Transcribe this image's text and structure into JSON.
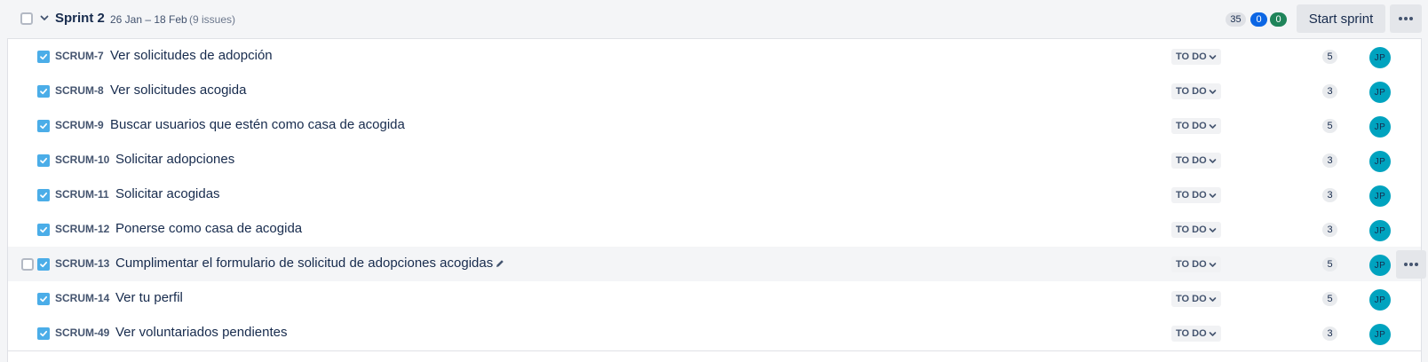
{
  "sprint": {
    "name": "Sprint 2",
    "dates": "26 Jan – 18 Feb",
    "issue_count": "(9 issues)",
    "story_points": {
      "total": "35",
      "in_progress": "0",
      "done": "0"
    },
    "start_button_label": "Start sprint"
  },
  "colors": {
    "in_progress_pill": "#0c66e4",
    "done_pill": "#1f845a",
    "avatar": "#00a3bf",
    "task_icon": "#4bade8"
  },
  "issues": [
    {
      "key": "SCRUM-7",
      "summary": "Ver solicitudes de adopción",
      "status": "TO DO",
      "points": "5",
      "assignee": "JP"
    },
    {
      "key": "SCRUM-8",
      "summary": "Ver solicitudes acogida",
      "status": "TO DO",
      "points": "3",
      "assignee": "JP"
    },
    {
      "key": "SCRUM-9",
      "summary": "Buscar usuarios que estén como casa de acogida",
      "status": "TO DO",
      "points": "5",
      "assignee": "JP"
    },
    {
      "key": "SCRUM-10",
      "summary": "Solicitar adopciones",
      "status": "TO DO",
      "points": "3",
      "assignee": "JP"
    },
    {
      "key": "SCRUM-11",
      "summary": "Solicitar acogidas",
      "status": "TO DO",
      "points": "3",
      "assignee": "JP"
    },
    {
      "key": "SCRUM-12",
      "summary": "Ponerse como casa de acogida",
      "status": "TO DO",
      "points": "3",
      "assignee": "JP"
    },
    {
      "key": "SCRUM-13",
      "summary": "Cumplimentar el formulario de solicitud de adopciones acogidas",
      "status": "TO DO",
      "points": "5",
      "assignee": "JP"
    },
    {
      "key": "SCRUM-14",
      "summary": "Ver tu perfil",
      "status": "TO DO",
      "points": "5",
      "assignee": "JP"
    },
    {
      "key": "SCRUM-49",
      "summary": "Ver voluntariados pendientes",
      "status": "TO DO",
      "points": "3",
      "assignee": "JP"
    }
  ]
}
